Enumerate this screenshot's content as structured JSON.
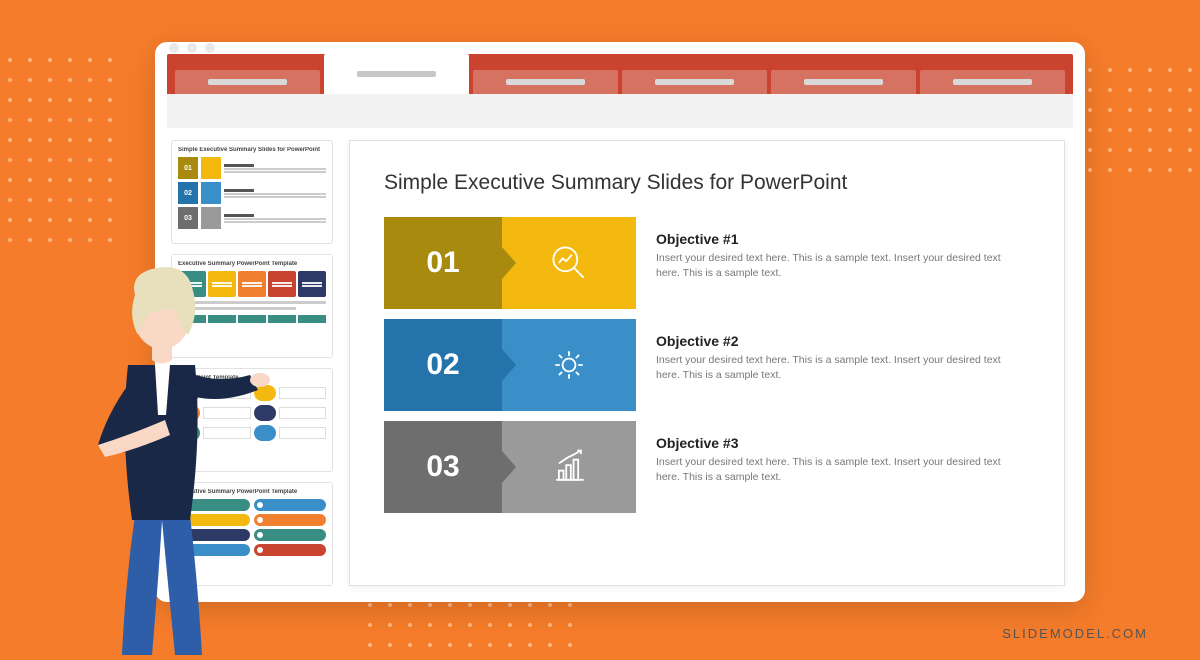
{
  "watermark": "SLIDEMODEL.COM",
  "slide": {
    "title": "Simple Executive Summary Slides for PowerPoint",
    "rows": [
      {
        "num": "01",
        "title": "Objective #1",
        "desc": "Insert your desired text here. This is a sample text. Insert your desired text here. This is a sample text."
      },
      {
        "num": "02",
        "title": "Objective #2",
        "desc": "Insert your desired text here. This is a sample text. Insert your desired text here. This is a sample text."
      },
      {
        "num": "03",
        "title": "Objective #3",
        "desc": "Insert your desired text here. This is a sample text. Insert your desired text here. This is a sample text."
      }
    ]
  },
  "thumbs": [
    {
      "title": "Simple Executive Summary Slides for PowerPoint"
    },
    {
      "title": "Executive Summary PowerPoint Template"
    },
    {
      "title": "PowerPoint Template"
    },
    {
      "title": "Executive Summary PowerPoint Template"
    }
  ],
  "colors": {
    "accent": "#f57c2a",
    "ribbon": "#c9432e",
    "yellow_dark": "#a88b0e",
    "yellow": "#f3b90e",
    "blue_dark": "#2573ab",
    "blue": "#3a8fc9",
    "gray_dark": "#6e6e6e",
    "gray": "#9a9a9a"
  }
}
